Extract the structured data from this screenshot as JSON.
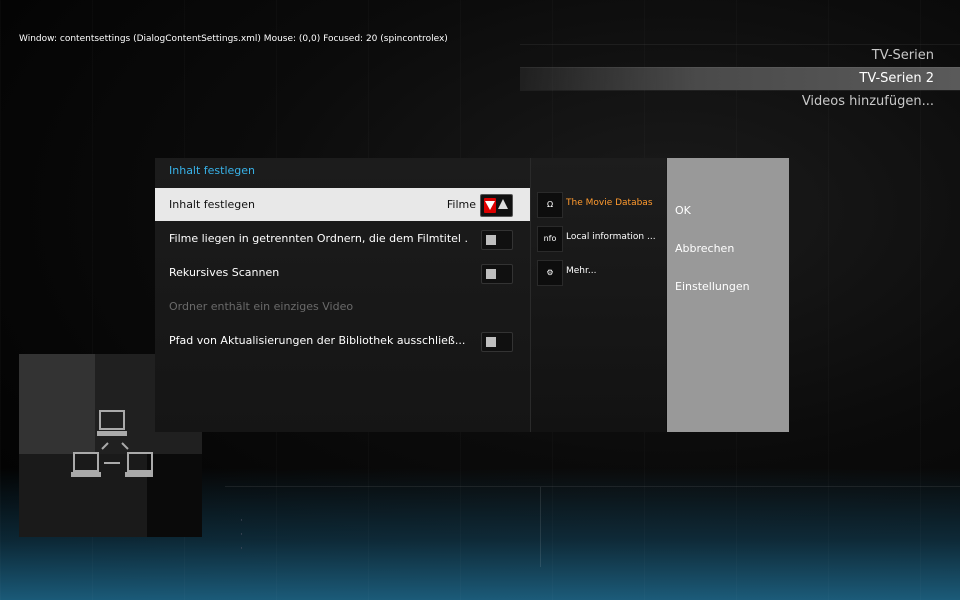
{
  "debug": "Window: contentsettings (DialogContentSettings.xml)  Mouse: (0,0)  Focused: 20 (spincontrolex)",
  "side_list": [
    "TV-Serien",
    "TV-Serien 2",
    "Videos hinzufügen..."
  ],
  "side_list_selected": 1,
  "dialog": {
    "title": "Inhalt festlegen",
    "settings": [
      {
        "label": "Inhalt festlegen",
        "value": "Filme",
        "control": "spin",
        "focused": true
      },
      {
        "label": "Filme liegen in getrennten Ordnern, die dem Filmtitel ...",
        "control": "toggle"
      },
      {
        "label": "Rekursives Scannen",
        "control": "toggle"
      },
      {
        "label": "Ordner enthält ein einziges Video",
        "control": "none",
        "disabled": true
      },
      {
        "label": "Pfad von Aktualisierungen der Bibliothek ausschließ...",
        "control": "toggle"
      }
    ],
    "scrapers": [
      {
        "label": "The Movie Databas",
        "icon": "tmdb-logo-icon",
        "selected": true
      },
      {
        "label": "Local information ...",
        "icon": "nfo-icon"
      },
      {
        "label": "Mehr...",
        "icon": "gear-icon"
      }
    ],
    "buttons": [
      "OK",
      "Abbrechen",
      "Einstellungen"
    ]
  },
  "colors": {
    "accent": "#38b2e8",
    "selected_scraper": "#ff9a2e",
    "spin_down": "#dd0000"
  }
}
